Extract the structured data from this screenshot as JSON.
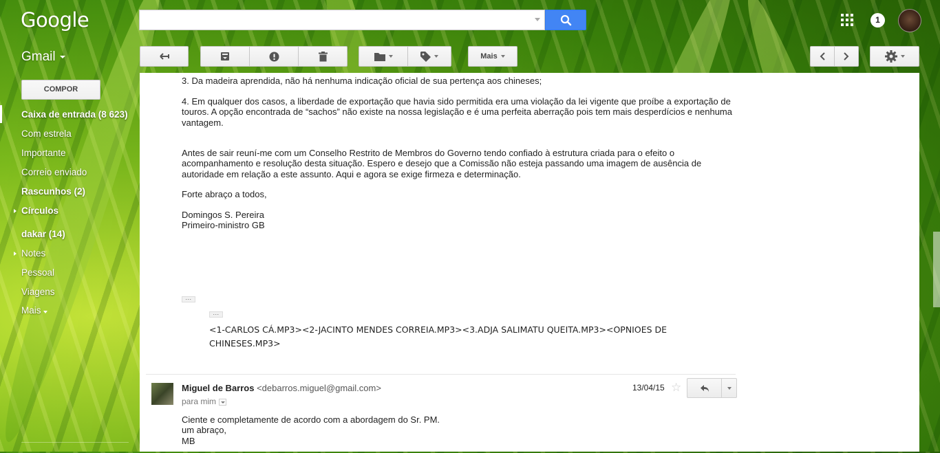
{
  "header": {
    "logo": "Google",
    "search": {
      "value": "",
      "placeholder": ""
    },
    "notification_count": "1"
  },
  "app": {
    "name": "Gmail"
  },
  "toolbar": {
    "more_label": "Mais"
  },
  "sidebar": {
    "compose_label": "COMPOR",
    "items": [
      {
        "label": "Caixa de entrada (8 623)"
      },
      {
        "label": "Com estrela"
      },
      {
        "label": "Importante"
      },
      {
        "label": "Correio enviado"
      },
      {
        "label": "Rascunhos (2)"
      },
      {
        "label": "Círculos"
      },
      {
        "label": "dakar (14)"
      },
      {
        "label": "Notes"
      },
      {
        "label": "Pessoal"
      },
      {
        "label": "Viagens"
      },
      {
        "label": "Mais"
      }
    ]
  },
  "message1": {
    "p3": "3. Da madeira aprendida, não há nenhuma indicação oficial de sua pertença aos chineses;",
    "p4_l1": "4. Em qualquer dos casos, a liberdade de exportação que havia sido permitida era uma violação da lei vigente que proíbe a exportação de",
    "p4_l2": "touros. A opção encontrada de “sachos” não existe na nossa legislação e é uma perfeita aberração pois tem mais desperdícios e nenhuma",
    "p4_l3": "vantagem.",
    "p5_l1": "Antes de sair reuní-me com um Conselho Restrito de Membros do Governo tendo confiado à estrutura criada para o efeito o",
    "p5_l2": "acompanhamento e resolução desta situação. Espero e desejo que a Comissão não esteja passando uma imagem de ausência de",
    "p5_l3": "autoridade em relação a este assunto. Aqui e agora se exige firmeza e determinação.",
    "closing": "Forte abraço a todos,",
    "sig_name": "Domingos S. Pereira",
    "sig_title": "Primeiro-ministro GB",
    "attachments_l1": "<1-CARLOS CÁ.MP3><2-JACINTO  MENDES CORREIA.MP3><3.ADJA SALIMATU QUEITA.MP3><OPNIOES DE",
    "attachments_l2": "CHINESES.MP3>"
  },
  "message2": {
    "sender_name": "Miguel de Barros",
    "sender_email": "<debarros.miguel@gmail.com>",
    "to": "para mim",
    "date": "13/04/15",
    "body_l1": "Ciente e completamente de acordo com a abordagem do Sr. PM.",
    "body_l2": "um abraço,",
    "body_l3": "MB"
  }
}
